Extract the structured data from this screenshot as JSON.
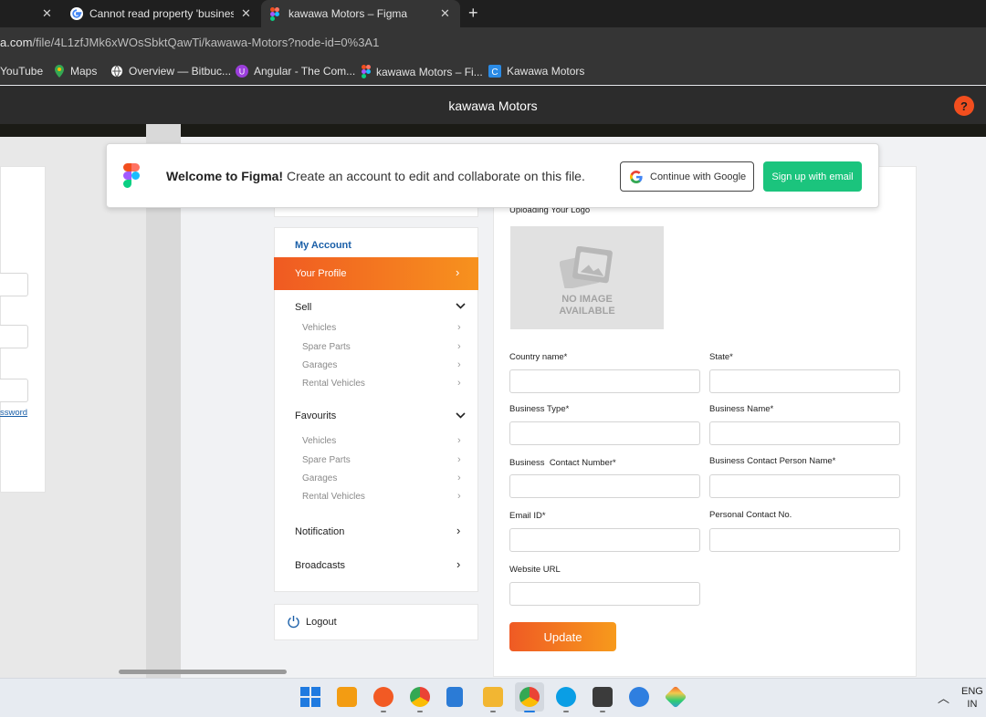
{
  "browser": {
    "tabs": [
      {
        "label": "",
        "close": "✕"
      },
      {
        "label": "Cannot read property 'businessLo",
        "close": "✕"
      },
      {
        "label": "kawawa Motors – Figma",
        "close": "✕"
      }
    ],
    "new_tab": "+",
    "url_prefix": "a.com",
    "url_rest": "/file/4L1zfJMk6xWOsSbktQawTi/kawawa-Motors?node-id=0%3A1",
    "bookmarks": [
      {
        "label": "YouTube"
      },
      {
        "label": "Maps"
      },
      {
        "label": "Overview — Bitbuc..."
      },
      {
        "label": "Angular - The Com..."
      },
      {
        "label": "kawawa Motors – Fi..."
      },
      {
        "label": "Kawawa Motors"
      }
    ]
  },
  "figma": {
    "title": "kawawa Motors",
    "help": "?",
    "banner": {
      "welcome": "Welcome to Figma!",
      "message": " Create an account to edit and collaborate on this file.",
      "google_btn": "Continue with Google",
      "email_btn": "Sign up with email"
    }
  },
  "left_panel": {
    "link": "ssword"
  },
  "sidebar": {
    "heading": "My Account",
    "profile": "Your Profile",
    "sell": {
      "label": "Sell",
      "items": [
        "Vehicles",
        "Spare Parts",
        "Garages",
        "Rental Vehicles"
      ]
    },
    "favourits": {
      "label": "Favourits",
      "items": [
        "Vehicles",
        "Spare Parts",
        "Garages",
        "Rental Vehicles"
      ]
    },
    "notification": "Notification",
    "broadcasts": "Broadcasts",
    "logout": "Logout"
  },
  "form": {
    "logo_label": "Uploading Your Logo",
    "no_image_line1": "NO IMAGE",
    "no_image_line2": "AVAILABLE",
    "fields": {
      "country": {
        "label": "Country name*",
        "value": ""
      },
      "state": {
        "label": "State*",
        "value": ""
      },
      "business_type": {
        "label": "Business Type*",
        "value": ""
      },
      "business_name": {
        "label": "Business Name*",
        "value": ""
      },
      "contact_number": {
        "label": "Business  Contact Number*",
        "value": ""
      },
      "contact_person": {
        "label": "Business Contact Person Name*",
        "value": ""
      },
      "email": {
        "label": "Email ID*",
        "value": ""
      },
      "personal_contact": {
        "label": "Personal Contact No.",
        "value": ""
      },
      "website": {
        "label": "Website URL",
        "value": ""
      }
    },
    "update_btn": "Update"
  },
  "taskbar": {
    "lang": "ENG",
    "region": "IN",
    "tray_arrow": "︿"
  },
  "colors": {
    "accent_orange": "#f05a22",
    "figma_green": "#1bc47d",
    "link_blue": "#1a5fa8"
  }
}
